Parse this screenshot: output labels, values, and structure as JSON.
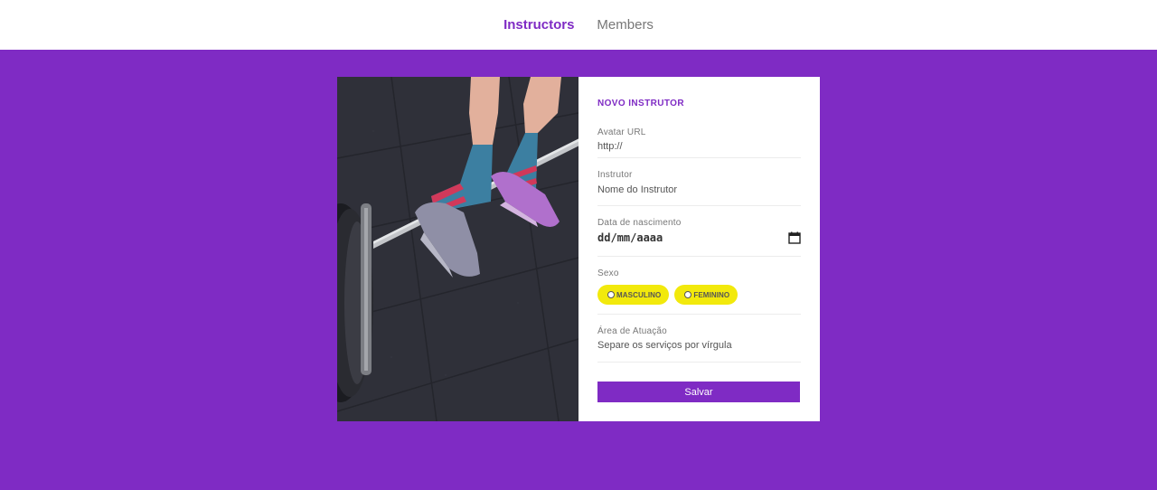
{
  "nav": {
    "items": [
      {
        "label": "Instructors",
        "active": true
      },
      {
        "label": "Members",
        "active": false
      }
    ]
  },
  "colors": {
    "brand": "#7f2bc4",
    "pill": "#f2e90c"
  },
  "form": {
    "title": "NOVO INSTRUTOR",
    "avatar": {
      "label": "Avatar URL",
      "placeholder": "http://"
    },
    "instrutor": {
      "label": "Instrutor",
      "placeholder": "Nome do Instrutor"
    },
    "birth": {
      "label": "Data de nascimento",
      "placeholder": "dd/mm/aaaa",
      "icon": "calendar-icon"
    },
    "gender": {
      "label": "Sexo",
      "options": [
        "MASCULINO",
        "FEMININO"
      ]
    },
    "area": {
      "label": "Área de Atuação",
      "placeholder": "Separe os serviços por vírgula"
    },
    "submit_label": "Salvar"
  }
}
